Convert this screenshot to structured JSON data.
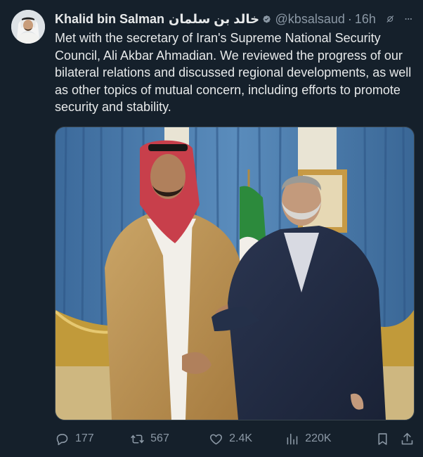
{
  "author": {
    "display_name": "Khalid bin Salman",
    "arabic_name": "خالد بن سلمان",
    "handle": "@kbsalsaud",
    "separator": "·",
    "time": "16h",
    "verified": true,
    "verified_color": "#8b98a5"
  },
  "tweet": {
    "text": "Met with the secretary of Iran's Supreme National Security Council, Ali Akbar Ahmadian. We reviewed the progress of our bilateral relations and discussed regional developments, as well as other topics of mutual concern, including efforts to promote security and stability."
  },
  "actions": {
    "replies": "177",
    "retweets": "567",
    "likes": "2.4K",
    "views": "220K"
  },
  "icons": {
    "reply": "speech-bubble-icon",
    "retweet": "retweet-arrows-icon",
    "like": "heart-icon",
    "views": "bar-chart-icon",
    "bookmark": "bookmark-icon",
    "share": "share-upload-icon",
    "grok": "grok-slash-icon",
    "more": "more-dots-icon"
  },
  "colors": {
    "background": "#15202b",
    "text": "#e7e9ea",
    "secondary": "#8b98a5",
    "border": "#38444d"
  }
}
